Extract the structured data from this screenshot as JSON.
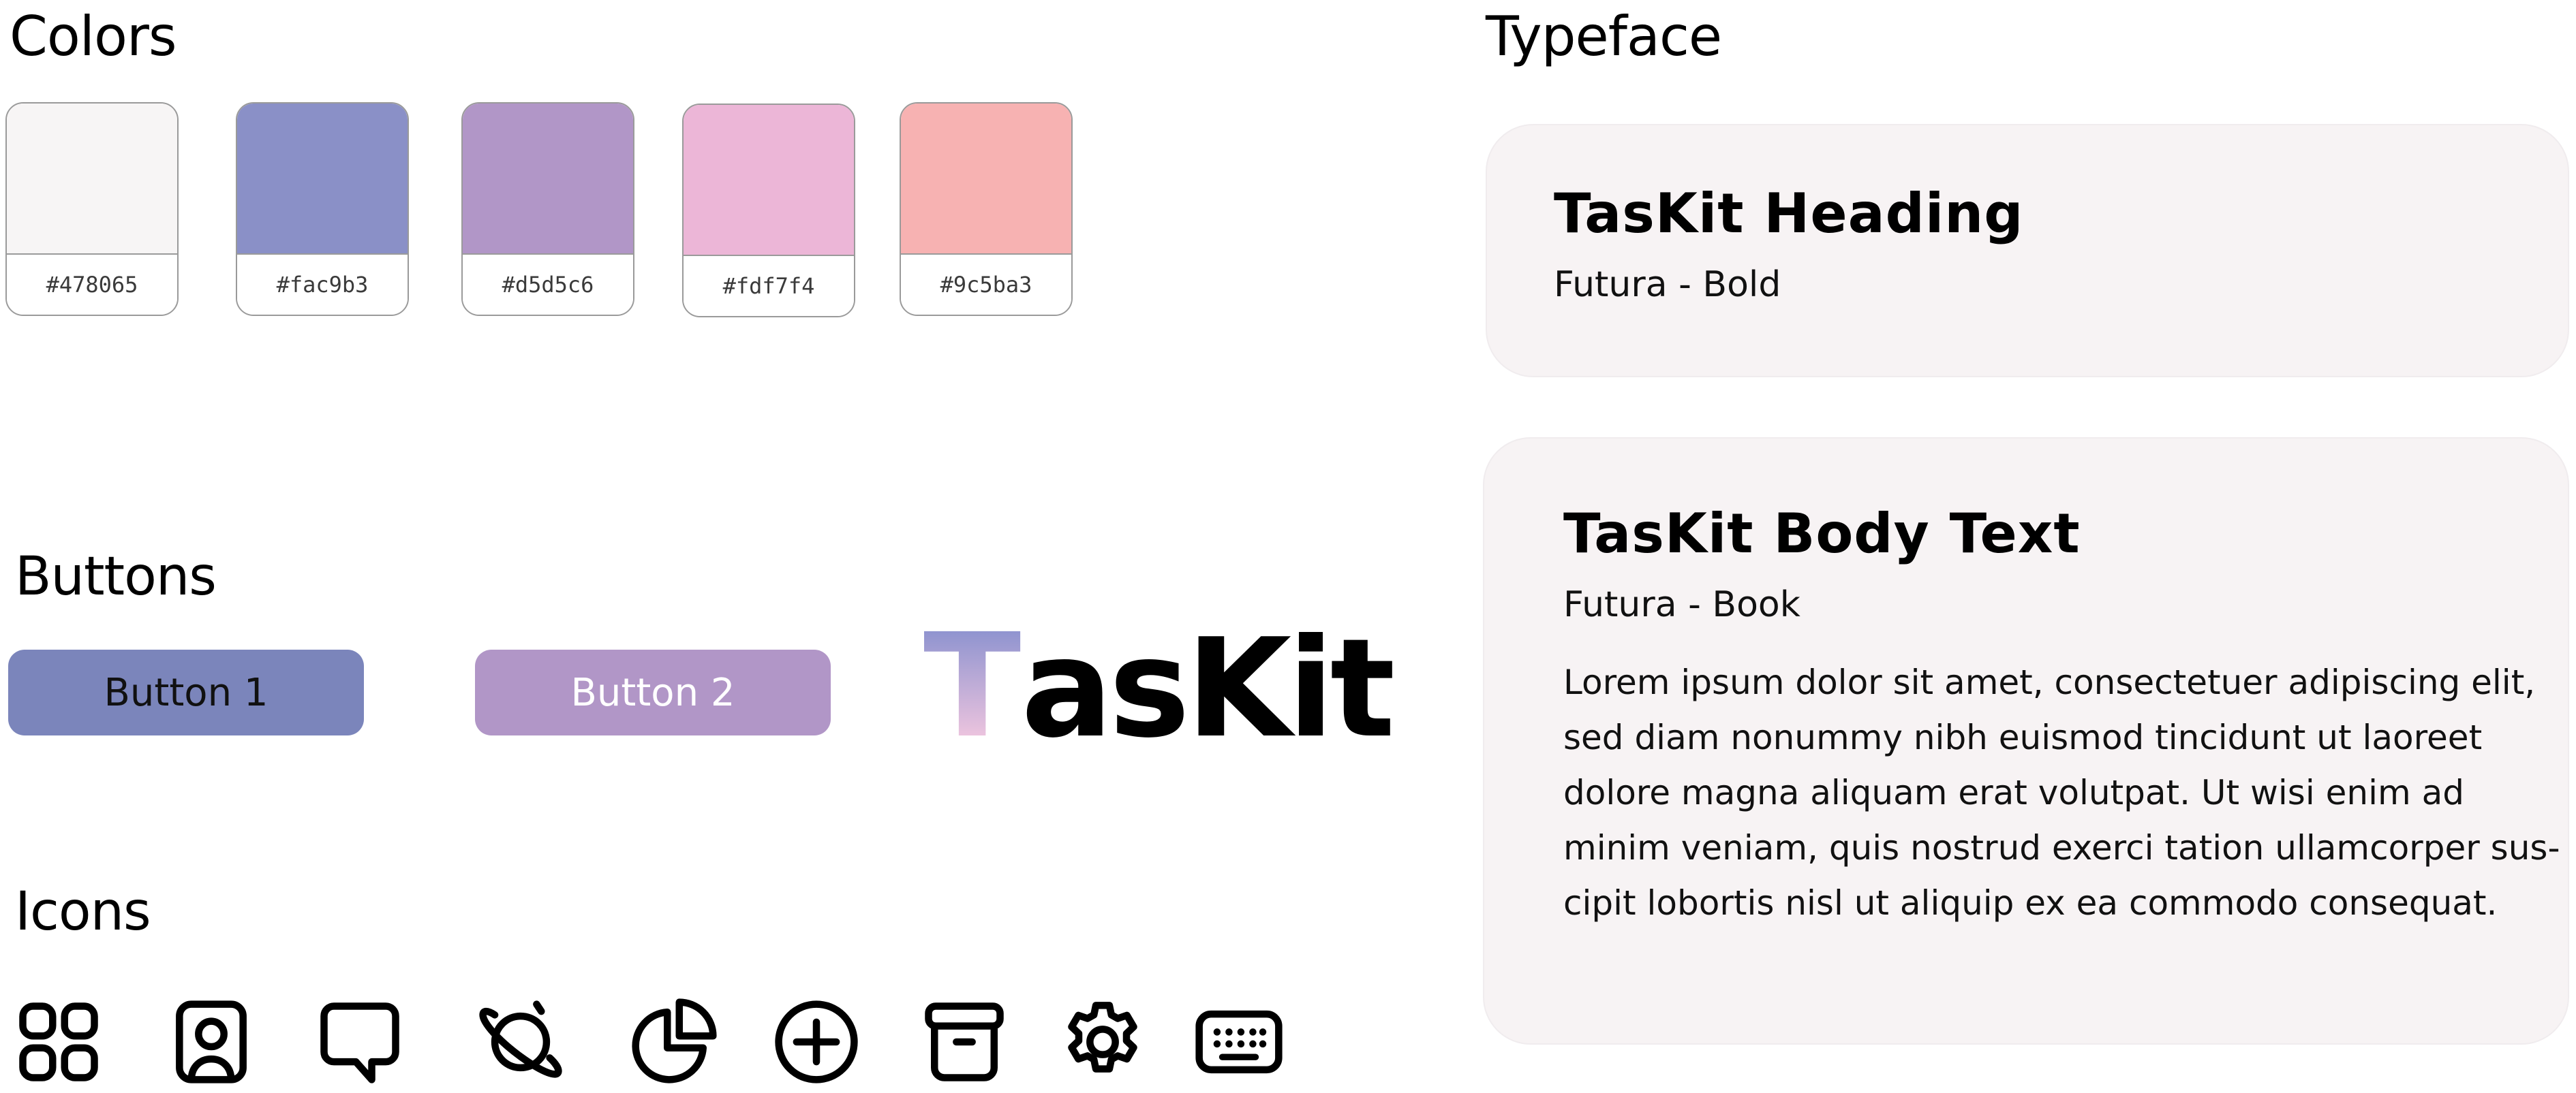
{
  "sections": {
    "colors": "Colors",
    "typeface": "Typeface",
    "buttons": "Buttons",
    "icons": "Icons"
  },
  "swatches": [
    {
      "label": "#478065",
      "color": "#f7f5f5"
    },
    {
      "label": "#fac9b3",
      "color": "#8a90c7"
    },
    {
      "label": "#d5d5c6",
      "color": "#b196c7"
    },
    {
      "label": "#fdf7f4",
      "color": "#ecb6d7"
    },
    {
      "label": "#9c5ba3",
      "color": "#f7b2b2"
    }
  ],
  "buttons": {
    "button1": "Button 1",
    "button2": "Button 2"
  },
  "logo": {
    "first_letter": "T",
    "rest": "asKit",
    "gradient": [
      "#8e93cf",
      "#f2c7df"
    ]
  },
  "icons": [
    "grid-icon",
    "contact-icon",
    "chat-icon",
    "planet-icon",
    "pie-chart-icon",
    "add-circle-icon",
    "archive-icon",
    "settings-icon",
    "keyboard-icon"
  ],
  "typeface": {
    "heading_card": {
      "title": "TasKit Heading",
      "font": "Futura - Bold"
    },
    "body_card": {
      "title": "TasKit Body Text",
      "font": "Futura - Book",
      "sample_lines": [
        "Lorem ipsum dolor sit amet, consectetuer adipiscing elit,",
        "sed diam nonummy nibh euismod tincidunt ut laoreet",
        "dolore magna aliquam erat volutpat. Ut wisi enim ad",
        "minim veniam, quis nostrud exerci tation ullamcorper sus-",
        "cipit lobortis nisl ut aliquip ex ea commodo consequat."
      ]
    }
  },
  "colors": {
    "card_bg": "#f7f3f4",
    "button1_bg": "#7b85bb",
    "button2_bg": "#b196c7"
  }
}
